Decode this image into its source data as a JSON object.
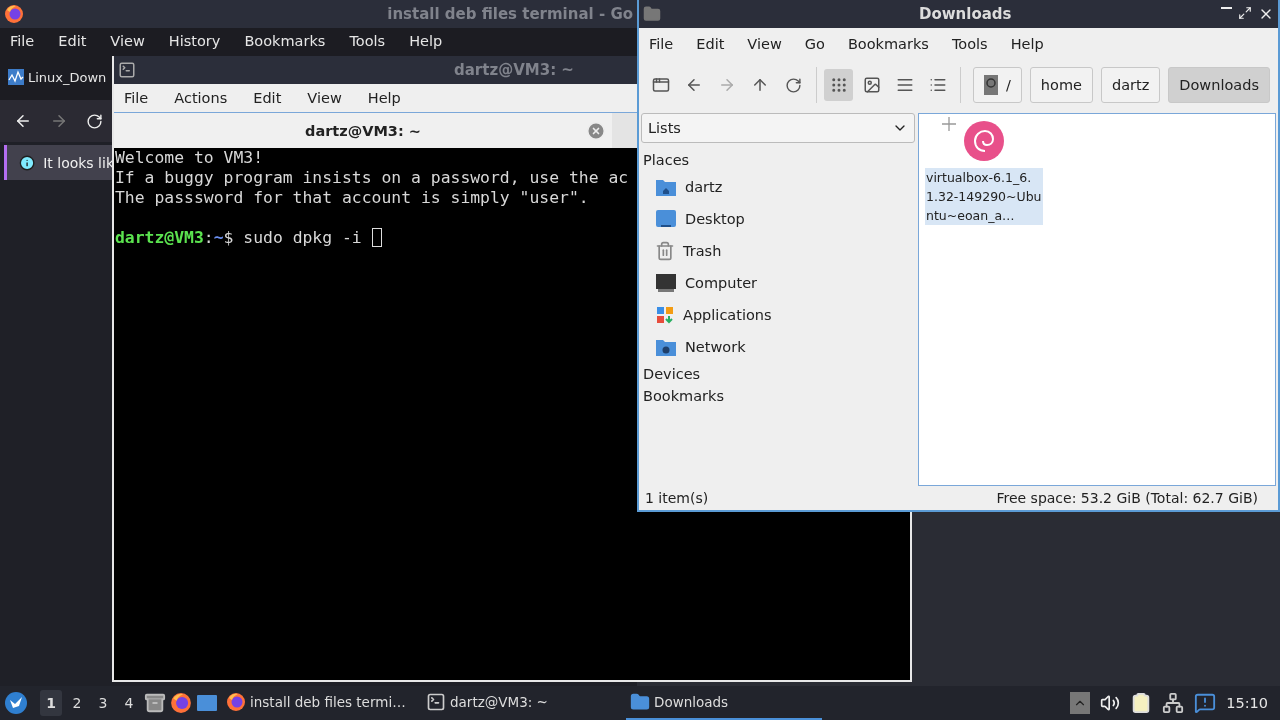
{
  "browser": {
    "title": "install deb files terminal - Go",
    "menu": [
      "File",
      "Edit",
      "View",
      "History",
      "Bookmarks",
      "Tools",
      "Help"
    ],
    "tab": "Linux_Down",
    "notice": "It looks lik"
  },
  "terminal": {
    "title": "dartz@VM3: ~",
    "menu": [
      "File",
      "Actions",
      "Edit",
      "View",
      "Help"
    ],
    "tab": "dartz@VM3: ~",
    "lines": [
      "Welcome to VM3!",
      "If a buggy program insists on a password, use the ac",
      "The passsword for that account is simply \"user\"."
    ],
    "prompt": {
      "user": "dartz@VM3",
      "sep": ":",
      "path": "~",
      "symbol": "$",
      "command": "sudo dpkg -i"
    }
  },
  "file_manager": {
    "title": "Downloads",
    "menu": [
      "File",
      "Edit",
      "View",
      "Go",
      "Bookmarks",
      "Tools",
      "Help"
    ],
    "view_modes": [
      {
        "kind": "icons",
        "selected": true
      },
      {
        "kind": "thumbnails",
        "selected": false
      },
      {
        "kind": "compact",
        "selected": false
      },
      {
        "kind": "details",
        "selected": false
      }
    ],
    "path": [
      {
        "label": "/",
        "kind": "root",
        "selected": false
      },
      {
        "label": "home",
        "kind": "folder",
        "selected": false
      },
      {
        "label": "dartz",
        "kind": "folder",
        "selected": false
      },
      {
        "label": "Downloads",
        "kind": "folder",
        "selected": true
      }
    ],
    "side_pane": {
      "mode": "Lists",
      "sections": [
        {
          "title": "Places",
          "items": [
            {
              "label": "dartz",
              "kind": "home"
            },
            {
              "label": "Desktop",
              "kind": "desktop"
            },
            {
              "label": "Trash",
              "kind": "trash"
            },
            {
              "label": "Computer",
              "kind": "computer"
            },
            {
              "label": "Applications",
              "kind": "applications"
            },
            {
              "label": "Network",
              "kind": "network"
            }
          ]
        },
        {
          "title": "Devices"
        },
        {
          "title": "Bookmarks"
        }
      ]
    },
    "files": [
      {
        "name": "virtualbox-6.1_6.1.32-149290~Ubuntu~eoan_a…",
        "kind": "debian",
        "selected": true
      }
    ],
    "status": {
      "count": "1 item(s)",
      "space": "Free space: 53.2 GiB (Total: 62.7 GiB)"
    }
  },
  "taskbar": {
    "workspaces": [
      {
        "label": "1",
        "selected": true
      },
      {
        "label": "2",
        "selected": false
      },
      {
        "label": "3",
        "selected": false
      },
      {
        "label": "4",
        "selected": false
      }
    ],
    "tasks": [
      {
        "label": "install deb files termi…",
        "kind": "browser",
        "selected": false
      },
      {
        "label": "dartz@VM3: ~",
        "kind": "terminal",
        "selected": false
      },
      {
        "label": "Downloads",
        "kind": "files",
        "selected": true
      }
    ],
    "clock": "15:10"
  }
}
